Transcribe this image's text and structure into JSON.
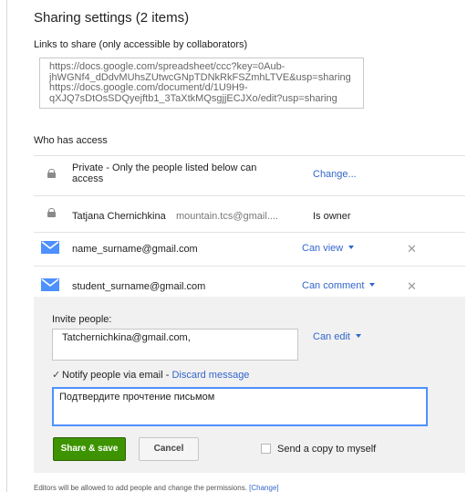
{
  "dialog": {
    "title": "Sharing settings (2 items)"
  },
  "links": {
    "label": "Links to share (only accessible by collaborators)",
    "text": "https://docs.google.com/spreadsheet/ccc?key=0Aub-\njhWGNf4_dDdvMUhsZUtwcGNpTDNkRkFSZmhLTVE&usp=sharing\nhttps://docs.google.com/document/d/1U9H9-\nqXJQ7sDtOsSDQyejftb1_3TaXtkMQsgjjECJXo/edit?usp=sharing"
  },
  "access": {
    "label": "Who has access",
    "private_text": "Private - Only the people listed below can access",
    "change_label": "Change...",
    "owner": {
      "name": "Tatjana Chernichkina",
      "email": "mountain.tcs@gmail....",
      "role": "Is owner"
    },
    "people": [
      {
        "email": "name_surname@gmail.com",
        "permission": "Can view"
      },
      {
        "email": "student_surname@gmail.com",
        "permission": "Can comment"
      }
    ]
  },
  "invite": {
    "label": "Invite people:",
    "value": "Tatchernichkina@gmail.com,",
    "permission": "Can edit",
    "notify_label": "Notify people via email",
    "notify_separator": " - ",
    "discard_label": "Discard message",
    "message": "Подтвердите прочтение письмом",
    "share_label": "Share & save",
    "cancel_label": "Cancel",
    "copy_label": "Send a copy to myself"
  },
  "footer": {
    "text": "Editors will be allowed to add people and change the permissions. ",
    "change_link": "[Change]"
  },
  "colors": {
    "accent": "#3366cc",
    "mail_icon": "#4d90fe",
    "share_button": "#3d9400"
  },
  "icons": {
    "lock": "lock-icon",
    "mail": "mail-icon",
    "remove": "close-icon"
  }
}
